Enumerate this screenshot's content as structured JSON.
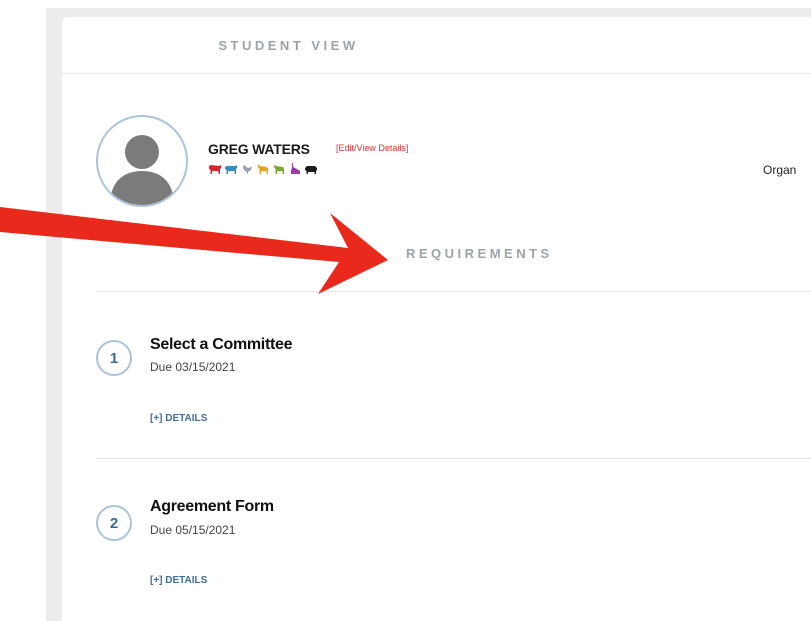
{
  "header": {
    "title": "STUDENT VIEW"
  },
  "student": {
    "name": "GREG WATERS",
    "edit_link": "[Edit/View Details]",
    "avatar": "user-silhouette-icon",
    "animal_icons": [
      {
        "name": "cattle-icon",
        "color": "#d8262d"
      },
      {
        "name": "dairy-cow-icon",
        "color": "#2f8fc6"
      },
      {
        "name": "poultry-icon",
        "color": "#9aa2a8"
      },
      {
        "name": "goat-icon",
        "color": "#e6a11f"
      },
      {
        "name": "sheep-icon",
        "color": "#7aa82f"
      },
      {
        "name": "rabbit-icon",
        "color": "#9a3ea6"
      },
      {
        "name": "swine-icon",
        "color": "#1c1c1c"
      }
    ]
  },
  "organization_label": "Organ",
  "requirements": {
    "title": "REQUIREMENTS",
    "items": [
      {
        "number": "1",
        "title": "Select a Committee",
        "due": "Due 03/15/2021",
        "details_label": "[+] DETAILS"
      },
      {
        "number": "2",
        "title": "Agreement Form",
        "due": "Due 05/15/2021",
        "details_label": "[+] DETAILS"
      }
    ]
  },
  "colors": {
    "accent_red": "#e8291c",
    "link_blue": "#3f6f98",
    "circle_border": "#a9c4d9",
    "header_gray": "#9ba3a9"
  }
}
